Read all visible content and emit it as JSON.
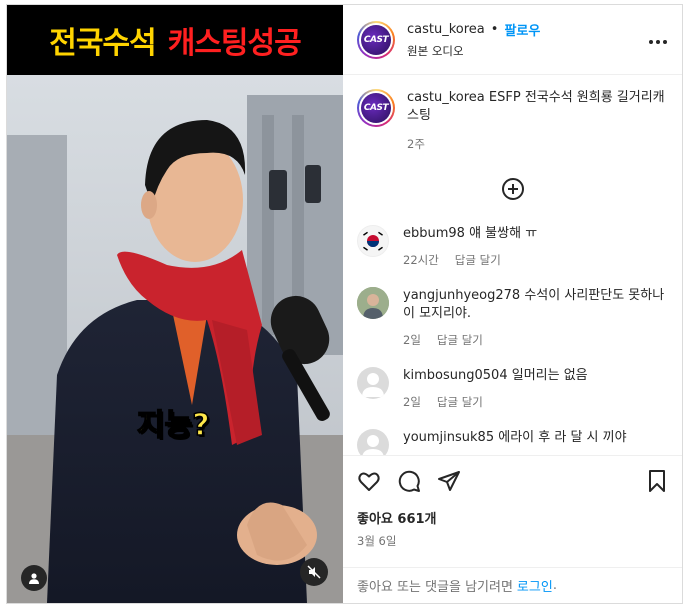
{
  "media": {
    "banner_left": "전국수석",
    "banner_right": "캐스팅성공",
    "overlay_caption": "지능?"
  },
  "header": {
    "username": "castu_korea",
    "separator": "•",
    "follow_label": "팔로우",
    "audio": "원본 오디오",
    "avatar_text": "CAST",
    "more_icon": "more-horizontal-icon"
  },
  "caption": {
    "username": "castu_korea",
    "text": "ESFP 전국수석 원희룡 길거리캐스팅",
    "time": "2주"
  },
  "comments": [
    {
      "username": "ebbum98",
      "text": "얘 불쌍해 ㅠ",
      "time": "22시간",
      "reply": "답글 달기"
    },
    {
      "username": "yangjunhyeog278",
      "text": "수석이 사리판단도 못하나 이 모지리야.",
      "time": "2일",
      "reply": "답글 달기"
    },
    {
      "username": "kimbosung0504",
      "text": "일머리는 없음",
      "time": "2일",
      "reply": "답글 달기"
    },
    {
      "username": "youmjinsuk85",
      "text": "에라이 후 라 달 시 끼야",
      "time": "",
      "reply": ""
    }
  ],
  "actions": {
    "likes": "좋아요 661개",
    "date": "3월 6일"
  },
  "login_bar": {
    "prompt": "좋아요 또는 댓글을 남기려면",
    "link": "로그인",
    "end": "."
  },
  "colors": {
    "accent": "#0095f6",
    "banner_yellow": "#ffd400",
    "banner_red": "#ff2020"
  }
}
